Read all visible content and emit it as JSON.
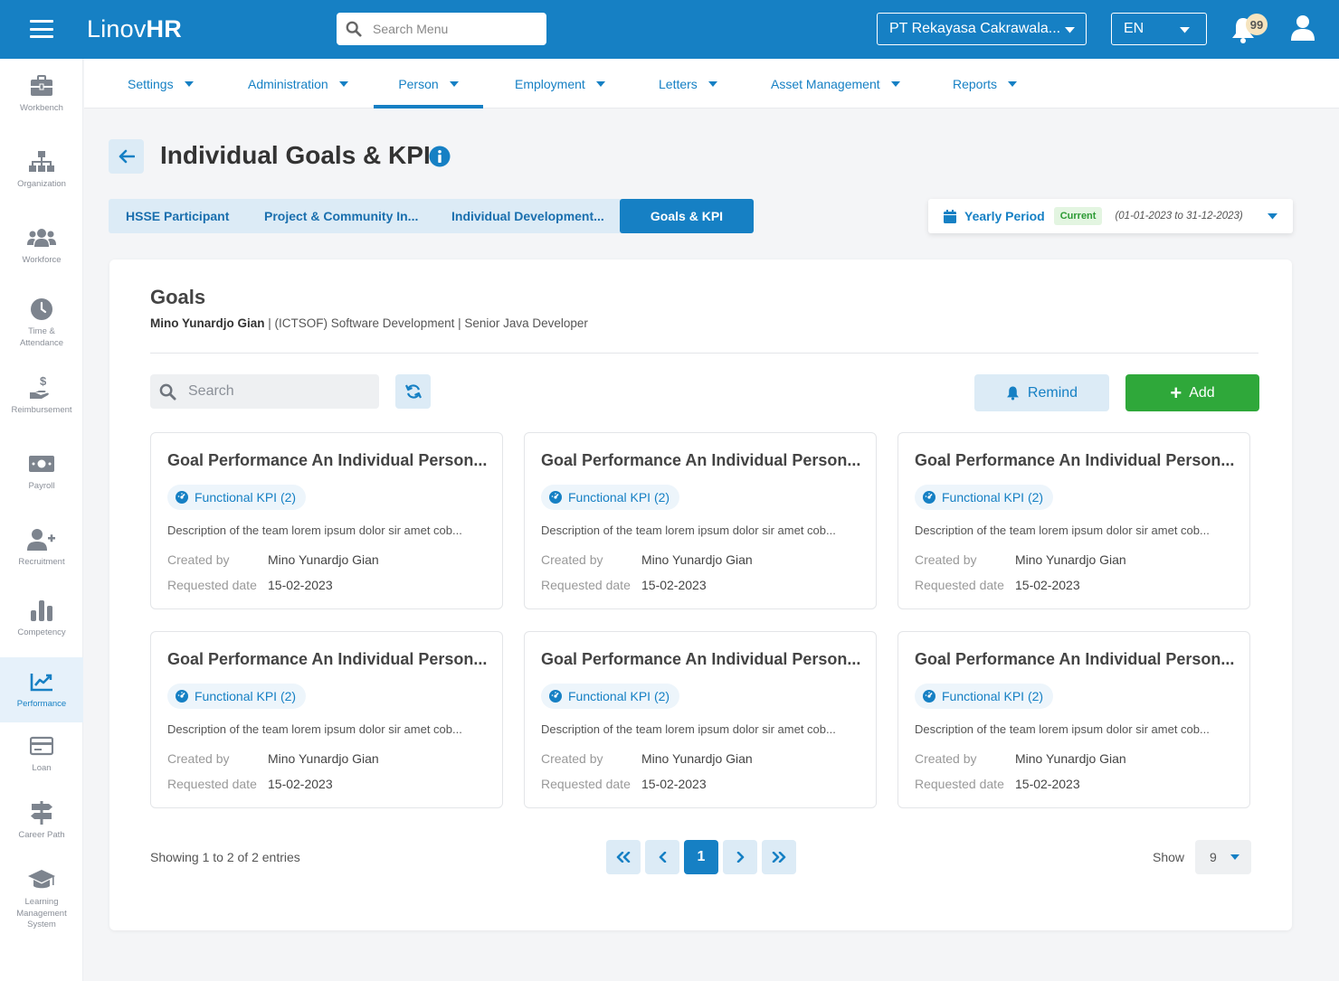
{
  "topbar": {
    "logo_light": "Linov",
    "logo_bold": "HR",
    "search_placeholder": "Search Menu",
    "company": "PT Rekayasa Cakrawala...",
    "language": "EN",
    "notification_count": "99",
    "brand_color": "#1680c4"
  },
  "sidebar": {
    "items": [
      {
        "label": "Workbench",
        "icon": "briefcase-icon"
      },
      {
        "label": "Organization",
        "icon": "org-chart-icon"
      },
      {
        "label": "Workforce",
        "icon": "users-icon"
      },
      {
        "label": "Time & Attendance",
        "icon": "clock-icon"
      },
      {
        "label": "Reimbursement",
        "icon": "hand-dollar-icon"
      },
      {
        "label": "Payroll",
        "icon": "money-icon"
      },
      {
        "label": "Recruitment",
        "icon": "user-plus-icon"
      },
      {
        "label": "Competency",
        "icon": "bar-chart-icon"
      },
      {
        "label": "Performance",
        "icon": "line-chart-icon",
        "active": true
      },
      {
        "label": "Loan",
        "icon": "credit-card-icon"
      },
      {
        "label": "Career Path",
        "icon": "signpost-icon"
      },
      {
        "label": "Learning Management System",
        "icon": "graduation-cap-icon"
      }
    ]
  },
  "subnav": {
    "items": [
      {
        "label": "Settings"
      },
      {
        "label": "Administration"
      },
      {
        "label": "Person",
        "active": true
      },
      {
        "label": "Employment"
      },
      {
        "label": "Letters"
      },
      {
        "label": "Asset Management"
      },
      {
        "label": "Reports"
      }
    ]
  },
  "page": {
    "title": "Individual Goals & KPI",
    "tabs": [
      {
        "label": "HSSE Participant"
      },
      {
        "label": "Project & Community In..."
      },
      {
        "label": "Individual Development..."
      },
      {
        "label": "Goals & KPI",
        "active": true
      }
    ],
    "period": {
      "label": "Yearly Period",
      "badge": "Current",
      "range": "(01-01-2023 to 31-12-2023)"
    }
  },
  "goals": {
    "title": "Goals",
    "employee_name": "Mino Yunardjo Gian",
    "employee_detail": " | (ICTSOF) Software Development | Senior Java Developer",
    "search_placeholder": "Search",
    "remind_label": "Remind",
    "add_label": "Add",
    "created_by_label": "Created by",
    "requested_date_label": "Requested date",
    "cards": [
      {
        "title": "Goal Performance An Individual Person...",
        "kpi": "Functional KPI (2)",
        "description": "Description of the team lorem ipsum dolor sir amet cob...",
        "created_by": "Mino Yunardjo Gian",
        "requested_date": "15-02-2023"
      },
      {
        "title": "Goal Performance An Individual Person...",
        "kpi": "Functional KPI (2)",
        "description": "Description of the team lorem ipsum dolor sir amet cob...",
        "created_by": "Mino Yunardjo Gian",
        "requested_date": "15-02-2023"
      },
      {
        "title": "Goal Performance An Individual Person...",
        "kpi": "Functional KPI (2)",
        "description": "Description of the team lorem ipsum dolor sir amet cob...",
        "created_by": "Mino Yunardjo Gian",
        "requested_date": "15-02-2023"
      },
      {
        "title": "Goal Performance An Individual Person...",
        "kpi": "Functional KPI (2)",
        "description": "Description of the team lorem ipsum dolor sir amet cob...",
        "created_by": "Mino Yunardjo Gian",
        "requested_date": "15-02-2023"
      },
      {
        "title": "Goal Performance An Individual Person...",
        "kpi": "Functional KPI (2)",
        "description": "Description of the team lorem ipsum dolor sir amet cob...",
        "created_by": "Mino Yunardjo Gian",
        "requested_date": "15-02-2023"
      },
      {
        "title": "Goal Performance An Individual Person...",
        "kpi": "Functional KPI (2)",
        "description": "Description of the team lorem ipsum dolor sir amet cob...",
        "created_by": "Mino Yunardjo Gian",
        "requested_date": "15-02-2023"
      }
    ],
    "pagination": {
      "showing": "Showing 1 to 2 of 2 entries",
      "current_page": "1",
      "show_label": "Show",
      "page_size": "9"
    }
  }
}
